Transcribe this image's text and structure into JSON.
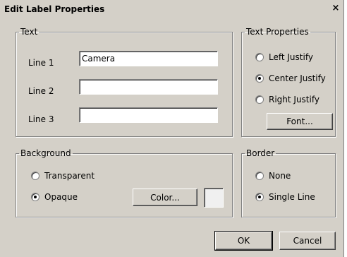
{
  "window": {
    "title": "Edit Label Properties",
    "close_glyph": "×"
  },
  "text_group": {
    "legend": "Text",
    "line1_label": "Line 1",
    "line1_value": "Camera",
    "line2_label": "Line 2",
    "line2_value": "",
    "line3_label": "Line 3",
    "line3_value": ""
  },
  "text_properties": {
    "legend": "Text Properties",
    "options": [
      "Left Justify",
      "Center Justify",
      "Right Justify"
    ],
    "selected": "Center Justify",
    "font_button": "Font..."
  },
  "background": {
    "legend": "Background",
    "options": [
      "Transparent",
      "Opaque"
    ],
    "selected": "Opaque",
    "color_button": "Color...",
    "swatch_color": "#f0f0f0"
  },
  "border": {
    "legend": "Border",
    "options": [
      "None",
      "Single Line"
    ],
    "selected": "Single Line"
  },
  "footer": {
    "ok": "OK",
    "cancel": "Cancel"
  }
}
